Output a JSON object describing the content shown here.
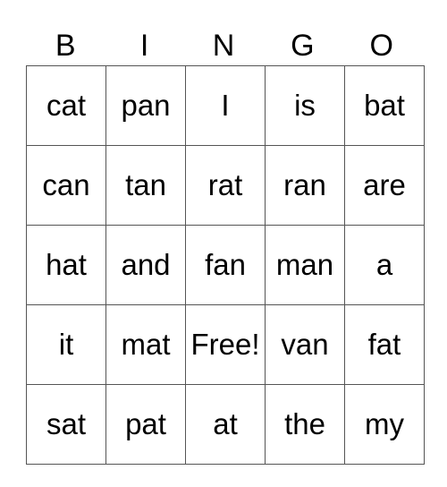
{
  "title_letters": [
    "B",
    "I",
    "N",
    "G",
    "O"
  ],
  "rows": [
    [
      "cat",
      "pan",
      "I",
      "is",
      "bat"
    ],
    [
      "can",
      "tan",
      "rat",
      "ran",
      "are"
    ],
    [
      "hat",
      "and",
      "fan",
      "man",
      "a"
    ],
    [
      "it",
      "mat",
      "Free!",
      "van",
      "fat"
    ],
    [
      "sat",
      "pat",
      "at",
      "the",
      "my"
    ]
  ]
}
